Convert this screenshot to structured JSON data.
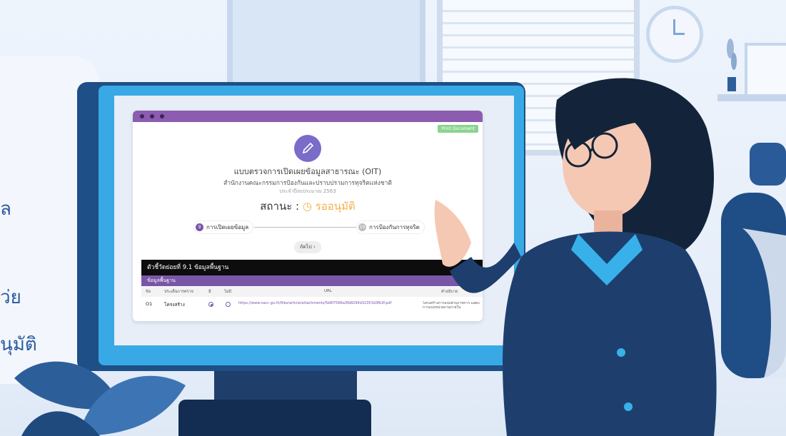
{
  "left_panel": {
    "lines": [
      "ล",
      "ว่ย",
      "นุมัติ"
    ]
  },
  "app": {
    "print_button": "Print Document",
    "title": "แบบตรวจการเปิดเผยข้อมูลสาธารณะ (OIT)",
    "organization": "สำนักงานคณะกรรมการป้องกันและปราบปรามการทุจริตแห่งชาติ",
    "year": "ประจำปีงบประมาณ 2563",
    "status_label": "สถานะ :",
    "status_value": "รออนุมัติ",
    "steps": [
      {
        "num": "9",
        "label": "การเปิดเผยข้อมูล",
        "color": "#7a56a8"
      },
      {
        "num": "10",
        "label": "การป้องกันการทุจริต",
        "color": "#bdbdbd"
      }
    ],
    "next_button": "ถัดไป ›",
    "section_title": "ตัวชี้วัดย่อยที่ 9.1 ข้อมูลพื้นฐาน",
    "subsection_title": "ข้อมูลพื้นฐาน",
    "table": {
      "headers": [
        "ข้อ",
        "ประเด็นการตรวจ",
        "มี",
        "ไม่มี",
        "URL",
        "คำอธิบาย"
      ],
      "row": {
        "no": "O1",
        "item": "โครงสร้าง",
        "url": "https://www.nacc.go.th/files/article/attachments/5b8f7566a3fb8294d32353d3fb3f.pdf",
        "desc": "โครงสร้างการแบ่งส่วนราชการ แสดงการแบ่งหน่วยงานภายใน"
      }
    }
  },
  "colors": {
    "accent_purple": "#7a56a8",
    "status_orange": "#f4b04a",
    "monitor_blue": "#39a9e6"
  }
}
